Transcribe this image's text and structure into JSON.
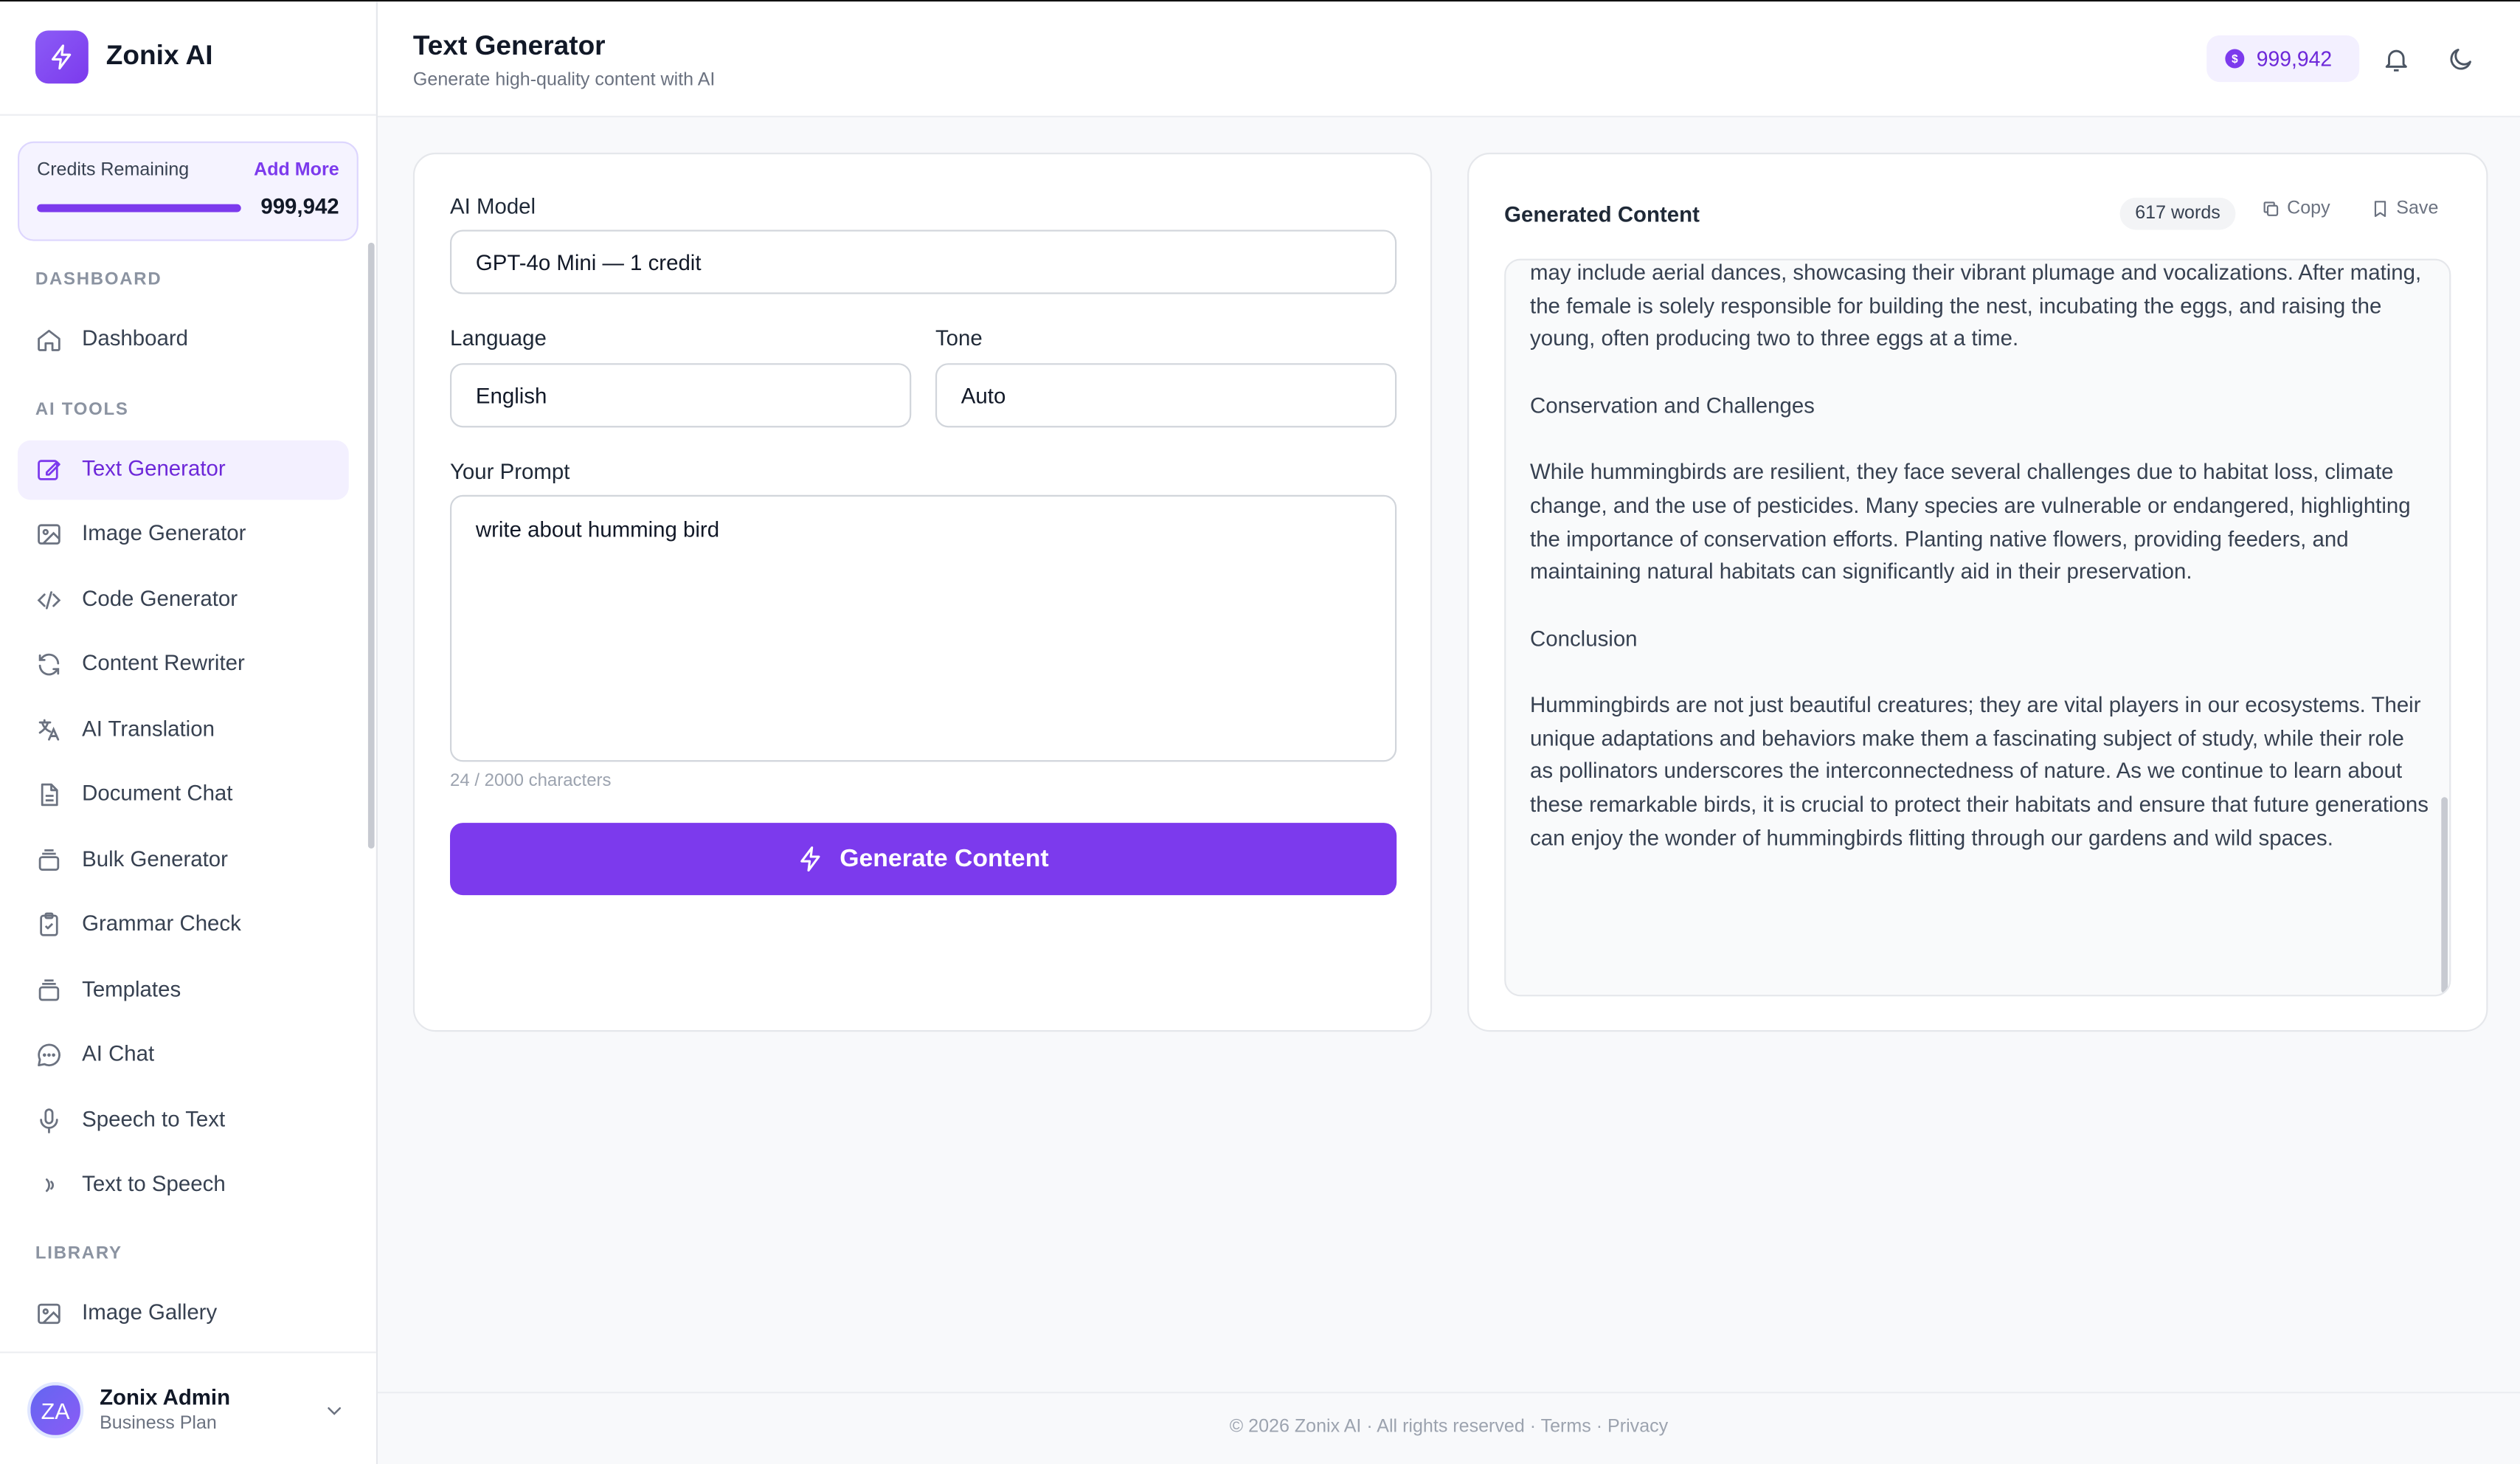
{
  "brand": {
    "name": "Zonix AI"
  },
  "credits": {
    "label": "Credits Remaining",
    "add_more": "Add More",
    "value": "999,942",
    "fill_fraction": 1.0
  },
  "nav": {
    "sections": {
      "dashboard": "DASHBOARD",
      "ai_tools": "AI TOOLS",
      "library": "LIBRARY"
    },
    "items": {
      "dashboard": "Dashboard",
      "text_generator": "Text Generator",
      "image_generator": "Image Generator",
      "code_generator": "Code Generator",
      "content_rewriter": "Content Rewriter",
      "ai_translation": "AI Translation",
      "document_chat": "Document Chat",
      "bulk_generator": "Bulk Generator",
      "grammar_check": "Grammar Check",
      "templates": "Templates",
      "ai_chat": "AI Chat",
      "speech_to_text": "Speech to Text",
      "text_to_speech": "Text to Speech",
      "image_gallery": "Image Gallery"
    }
  },
  "user": {
    "initials": "ZA",
    "name": "Zonix Admin",
    "plan": "Business Plan"
  },
  "header": {
    "title": "Text Generator",
    "subtitle": "Generate high-quality content with AI",
    "balance": "999,942"
  },
  "form": {
    "model_label": "AI Model",
    "model_value": "GPT-4o Mini — 1 credit",
    "language_label": "Language",
    "language_value": "English",
    "tone_label": "Tone",
    "tone_value": "Auto",
    "prompt_label": "Your Prompt",
    "prompt_value": "write about humming bird",
    "char_count": "24 / 2000 characters",
    "generate_label": "Generate Content"
  },
  "output": {
    "title": "Generated Content",
    "words": "617 words",
    "copy_label": "Copy",
    "save_label": "Save",
    "paragraphs": [
      "may include aerial dances, showcasing their vibrant plumage and vocalizations. After mating, the female is solely responsible for building the nest, incubating the eggs, and raising the young, often producing two to three eggs at a time.",
      "Conservation and Challenges",
      "While hummingbirds are resilient, they face several challenges due to habitat loss, climate change, and the use of pesticides. Many species are vulnerable or endangered, highlighting the importance of conservation efforts. Planting native flowers, providing feeders, and maintaining natural habitats can significantly aid in their preservation.",
      "Conclusion",
      "Hummingbirds are not just beautiful creatures; they are vital players in our ecosystems. Their unique adaptations and behaviors make them a fascinating subject of study, while their role as pollinators underscores the interconnectedness of nature. As we continue to learn about these remarkable birds, it is crucial to protect their habitats and ensure that future generations can enjoy the wonder of hummingbirds flitting through our gardens and wild spaces."
    ]
  },
  "footer": {
    "text": "© 2026 Zonix AI · All rights reserved · Terms · Privacy"
  },
  "colors": {
    "accent": "#7c3aed",
    "accent_light": "#f3f0ff"
  }
}
